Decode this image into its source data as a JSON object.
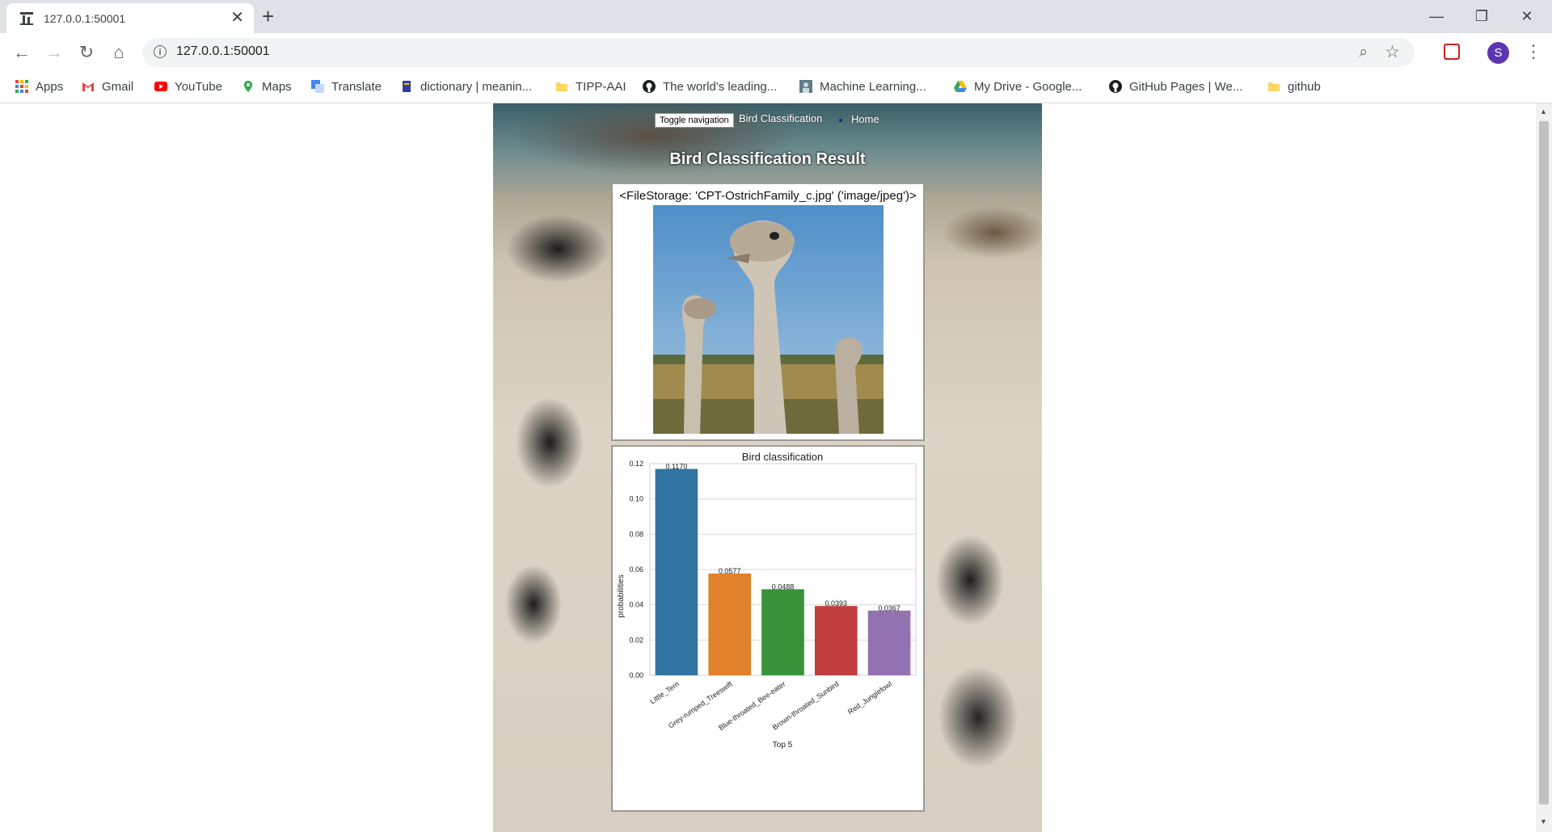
{
  "browser": {
    "tab_title": "127.0.0.1:50001",
    "url": "127.0.0.1:50001",
    "profile_initial": "S",
    "bookmarks": [
      "Apps",
      "Gmail",
      "YouTube",
      "Maps",
      "Translate",
      "dictionary | meanin...",
      "TIPP-AAI",
      "The world's leading...",
      "Machine Learning...",
      "My Drive - Google...",
      "GitHub Pages | We...",
      "github"
    ]
  },
  "nav": {
    "toggle_label": "Toggle navigation",
    "brand": "Bird Classification",
    "home": "Home"
  },
  "page": {
    "title": "Bird Classification Result",
    "file_caption": "<FileStorage: 'CPT-OstrichFamily_c.jpg' ('image/jpeg')>"
  },
  "colors": {
    "bar1": "#3274a1",
    "bar2": "#e1812c",
    "bar3": "#3a923a",
    "bar4": "#c03d3e",
    "bar5": "#9372b2"
  },
  "chart_data": {
    "type": "bar",
    "title": "Bird classification",
    "xlabel": "Top 5",
    "ylabel": "probabilities",
    "categories": [
      "Little_Tern",
      "Grey-rumped_Treeswift",
      "Blue-throated_Bee-eater",
      "Brown-throated_Sunbird",
      "Red_Junglefowl"
    ],
    "values": [
      0.117,
      0.0577,
      0.0488,
      0.0393,
      0.0367
    ],
    "value_labels": [
      "0.1170",
      "0.0577",
      "0.0488",
      "0.0393",
      "0.0367"
    ],
    "ylim": [
      0,
      0.12
    ],
    "yticks": [
      "0.00",
      "0.02",
      "0.04",
      "0.06",
      "0.08",
      "0.10",
      "0.12"
    ],
    "grid": true
  }
}
